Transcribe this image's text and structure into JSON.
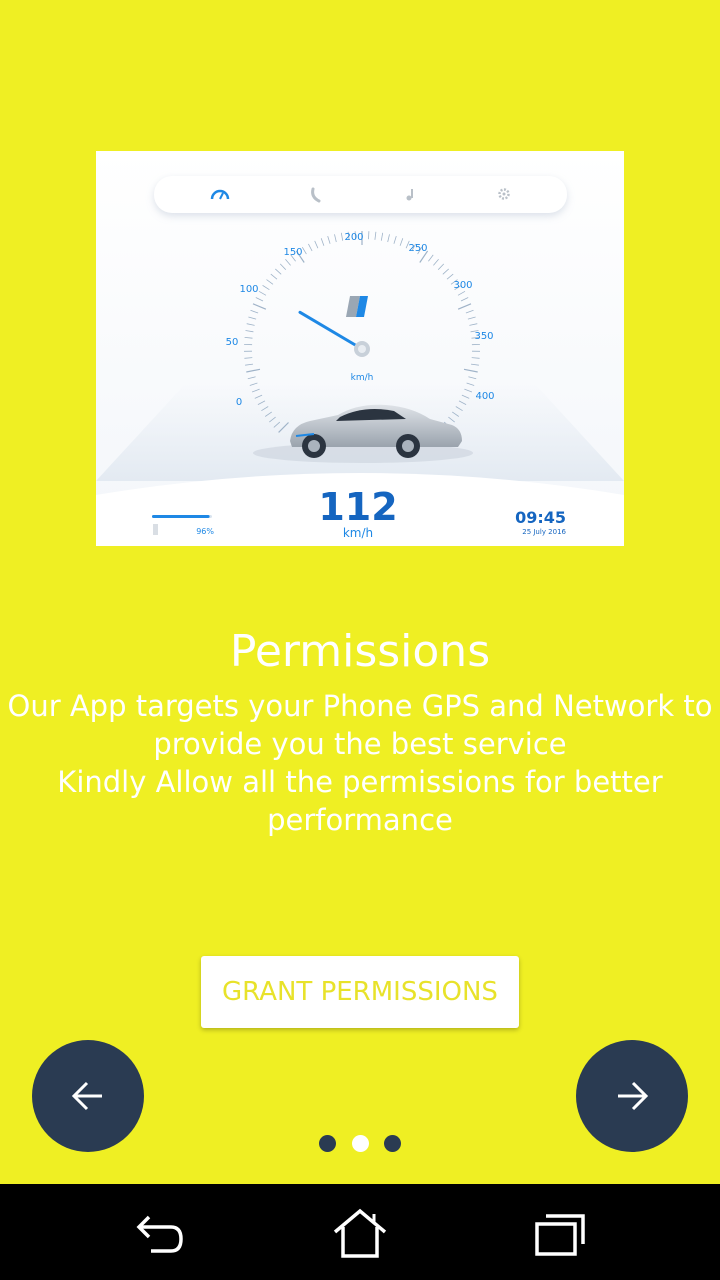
{
  "colors": {
    "background": "#EFEF23",
    "fab": "#2A3B52",
    "accent": "#1E88E5",
    "button_text": "#E8E22A",
    "dot_active": "#FFFFFF",
    "dot_inactive": "#2A3B52"
  },
  "hero": {
    "tabs": [
      "speedometer-icon",
      "phone-icon",
      "music-icon",
      "settings-icon"
    ],
    "gauge_ticks": [
      "0",
      "50",
      "100",
      "150",
      "200",
      "250",
      "300",
      "350",
      "400"
    ],
    "gauge_unit": "km/h",
    "speed": "112",
    "speed_unit": "km/h",
    "battery_percent": "96%",
    "battery_level": 0.96,
    "time": "09:45",
    "date": "25 July 2016",
    "needle_speed": 112
  },
  "title": "Permissions",
  "description": [
    "Our App targets your Phone GPS and Network to",
    "provide you the best service",
    "Kindly Allow all the permissions for better",
    "performance"
  ],
  "grant_button": "GRANT PERMISSIONS",
  "pager": {
    "total": 3,
    "active": 1
  },
  "fab_prev_icon": "arrow-left-icon",
  "fab_next_icon": "arrow-right-icon",
  "navbar": [
    "back-icon",
    "home-icon",
    "recents-icon"
  ]
}
